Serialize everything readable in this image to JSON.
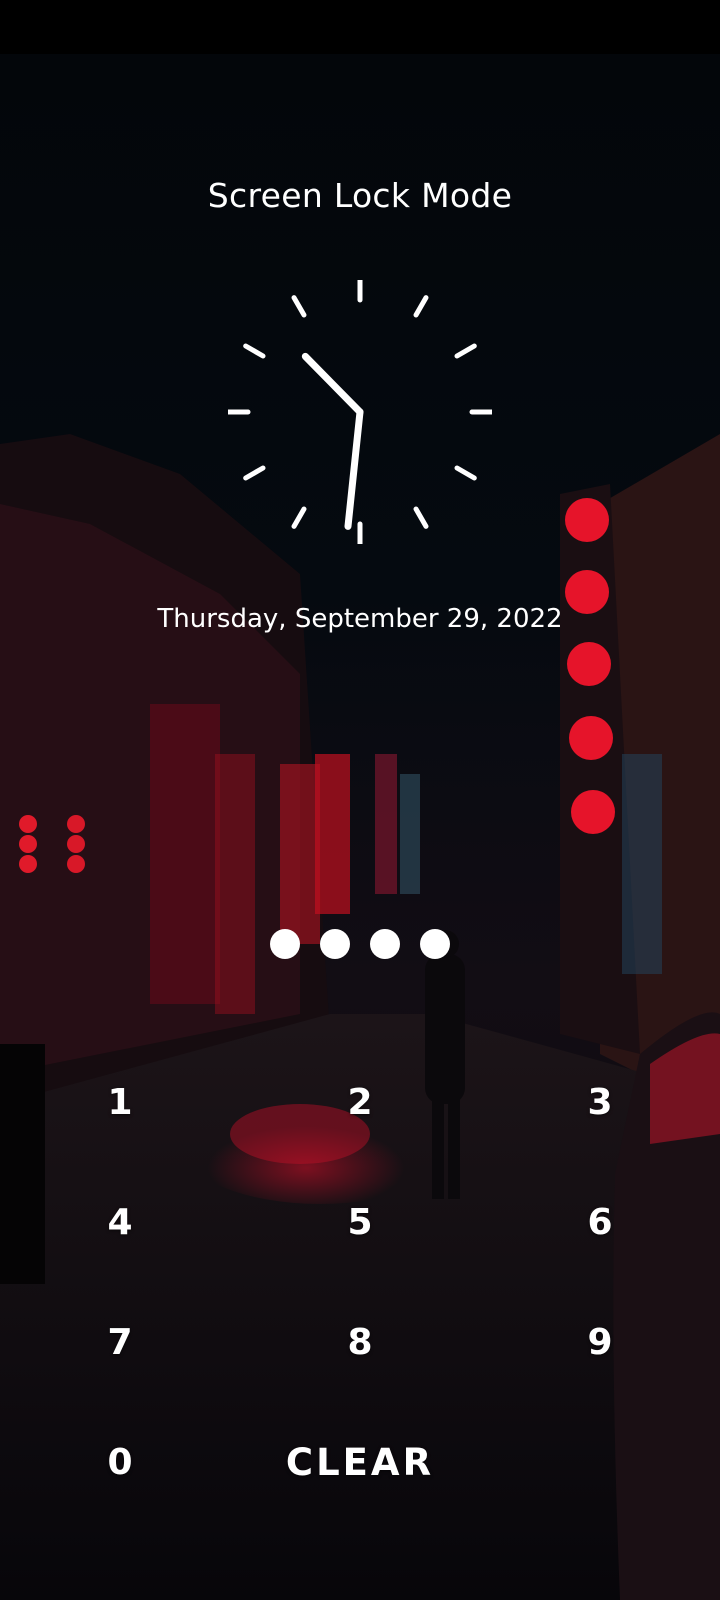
{
  "screen": {
    "title": "Screen Lock Mode",
    "date": "Thursday, September 29, 2022"
  },
  "clock": {
    "hour": 10,
    "minute": 31,
    "hand_color": "#ffffff",
    "marker_color": "#ffffff"
  },
  "pin": {
    "entered_count": 4,
    "dot_color": "#ffffff"
  },
  "keypad": {
    "keys": [
      "1",
      "2",
      "3",
      "4",
      "5",
      "6",
      "7",
      "8",
      "9",
      "0"
    ],
    "clear_label": "CLEAR"
  },
  "wallpaper": {
    "description_colors": {
      "sky": "#04070b",
      "neon_red": "#e0102a",
      "street": "#1a0f14"
    }
  }
}
